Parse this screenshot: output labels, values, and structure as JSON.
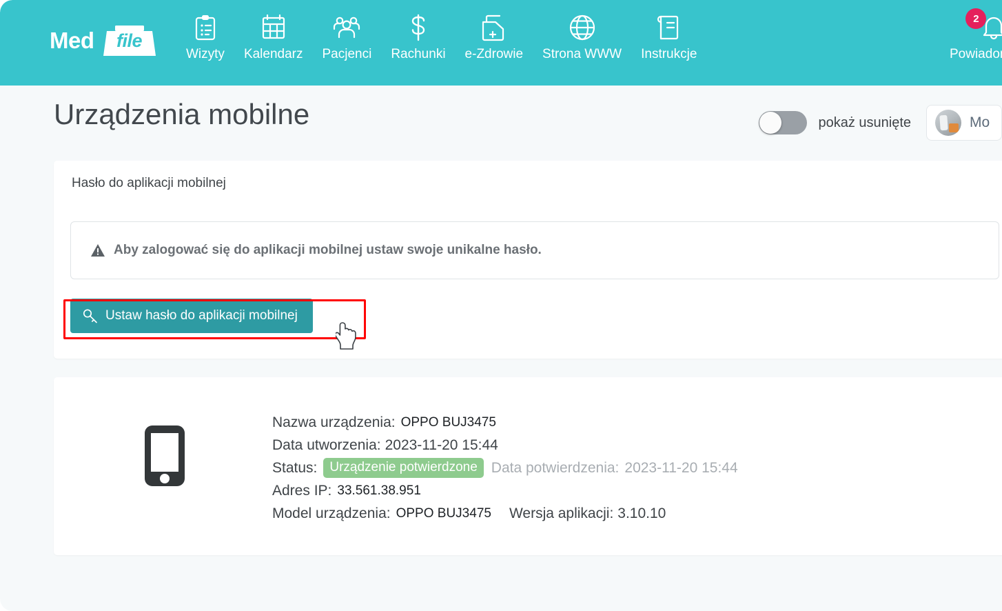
{
  "brand": {
    "word1": "Med",
    "word2": "file"
  },
  "nav": {
    "items": [
      {
        "label": "Wizyty",
        "icon": "clipboard-icon"
      },
      {
        "label": "Kalendarz",
        "icon": "calendar-icon"
      },
      {
        "label": "Pacjenci",
        "icon": "people-icon"
      },
      {
        "label": "Rachunki",
        "icon": "dollar-icon"
      },
      {
        "label": "e-Zdrowie",
        "icon": "health-document-icon"
      },
      {
        "label": "Strona WWW",
        "icon": "globe-icon"
      },
      {
        "label": "Instrukcje",
        "icon": "book-icon"
      }
    ],
    "notifications": {
      "label": "Powiadomienia",
      "count": "2",
      "icon": "bell-icon"
    }
  },
  "header": {
    "title": "Urządzenia mobilne",
    "toggle_label": "pokaż usunięte",
    "toggle_state": "off",
    "user_name": "Mo"
  },
  "password_card": {
    "title": "Hasło do aplikacji mobilnej",
    "alert_text": "Aby zalogować się do aplikacji mobilnej ustaw swoje unikalne hasło.",
    "button_label": "Ustaw hasło do aplikacji mobilnej",
    "button_icon": "key-icon"
  },
  "device": {
    "icon": "mobile-phone-icon",
    "name_label": "Nazwa urządzenia:",
    "name_value": "OPPO BUJ3475",
    "created_label": "Data utworzenia:",
    "created_value": "2023-11-20 15:44",
    "status_label": "Status:",
    "status_badge": "Urządzenie potwierdzone",
    "confirmed_label": "Data potwierdzenia:",
    "confirmed_value": "2023-11-20 15:44",
    "ip_label": "Adres IP:",
    "ip_value": "33.561.38.951",
    "model_label": "Model urządzenia:",
    "model_value": "OPPO BUJ3475",
    "app_version_label": "Wersja aplikacji:",
    "app_version_value": "3.10.10"
  },
  "colors": {
    "navbar_teal": "#38c4cc",
    "button_teal": "#2e9ba3",
    "badge_pink": "#e5205c",
    "status_green": "#8ecb8e",
    "highlight_red": "#ff0000",
    "page_bg": "#f6f9fa"
  }
}
